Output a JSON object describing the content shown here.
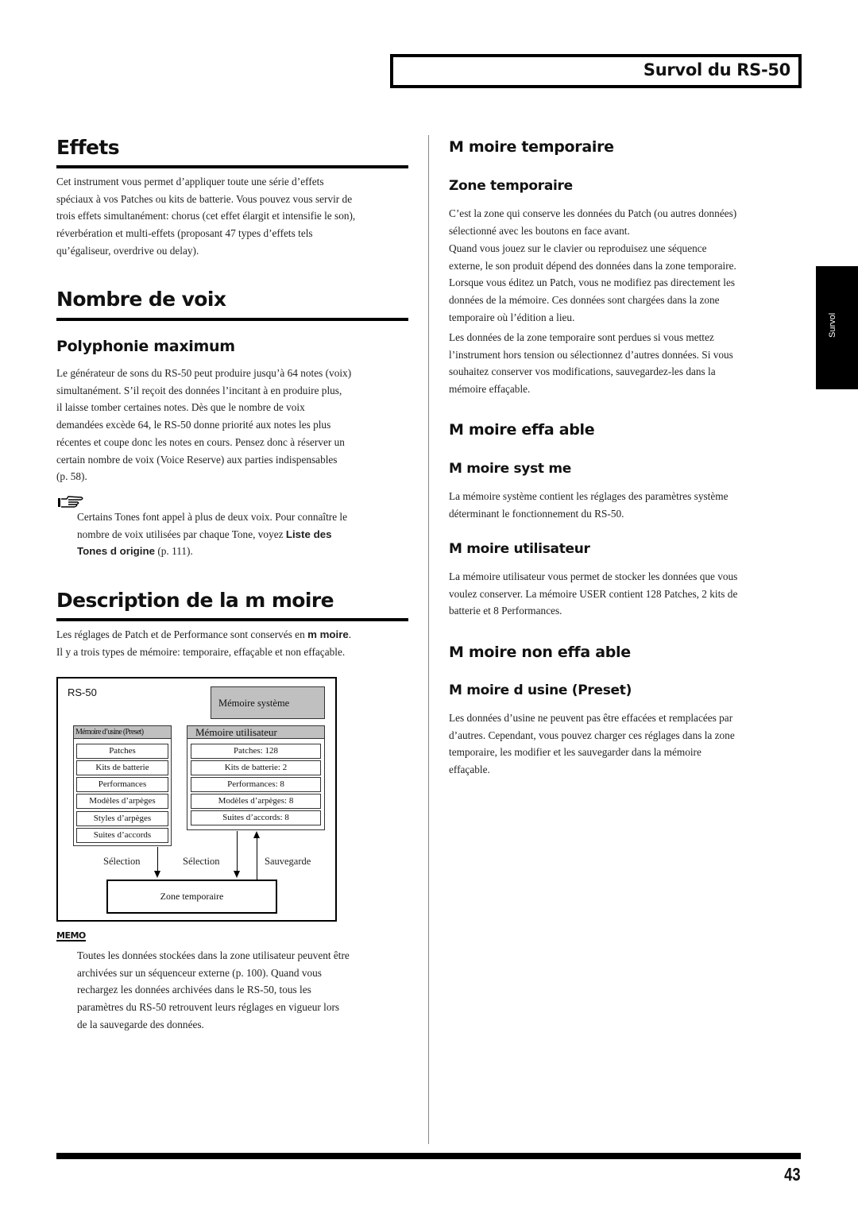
{
  "header": {
    "title": "Survol du RS-50"
  },
  "side_tab": {
    "label": "Survol"
  },
  "left": {
    "effets": {
      "heading": "Effets",
      "lines": [
        "Cet instrument vous permet d’appliquer toute une série d’effets",
        "spéciaux à vos Patches ou kits de batterie. Vous pouvez vous servir de",
        "trois effets simultanément: chorus (cet effet élargit et intensifie le son),",
        "réverbération et multi-effets (proposant 47 types d’effets tels",
        "qu’égaliseur, overdrive ou delay)."
      ]
    },
    "voix": {
      "heading": "Nombre de voix",
      "subheading": "Polyphonie maximum",
      "lines": [
        "Le générateur de sons du RS-50 peut produire jusqu’à 64 notes (voix)",
        "simultanément. S’il reçoit des données l’incitant à en produire plus,",
        "il laisse tomber certaines notes. Dès que le nombre de voix",
        "demandées excède 64, le RS-50 donne priorité aux notes les plus",
        "récentes et coupe donc les notes en cours. Pensez donc à réserver un",
        "certain nombre de voix (Voice Reserve) aux parties indispensables",
        "(p. 58)."
      ],
      "note": {
        "icon": "pointing-hand-icon",
        "line1": "Certains Tones font appel à plus de deux voix. Pour connaître le",
        "line2_text": "nombre de voix utilisées par chaque Tone, voyez ",
        "line2_bold": "Liste des",
        "line3_bold": "Tones d origine",
        "line3_text": " (p. 111)."
      }
    },
    "memoire": {
      "heading": "Description de la m  moire",
      "line1_text": "Les réglages de Patch et de Performance sont conservés en ",
      "line1_bold": "m  moire",
      "line1_end": ".",
      "line2": "Il y a trois types de mémoire: temporaire, effaçable et non effaçable."
    },
    "diagram": {
      "device": "RS-50",
      "system_memory": "Mémoire système",
      "preset": {
        "title": "Mémoire d’usine (Preset)",
        "items": [
          "Patches",
          "Kits de batterie",
          "Performances",
          "Modèles d’arpèges",
          "Styles d’arpèges",
          "Suites d’accords"
        ]
      },
      "user": {
        "title": "Mémoire utilisateur",
        "items": [
          "Patches: 128",
          "Kits de batterie: 2",
          "Performances: 8",
          "Modèles d’arpèges: 8",
          "Suites d’accords: 8"
        ]
      },
      "arrows": {
        "selection_preset": "Sélection",
        "selection_user": "Sélection",
        "save": "Sauvegarde"
      },
      "temp_zone": "Zone temporaire"
    },
    "memo": {
      "icon_label": "MEMO",
      "lines": [
        "Toutes les données stockées dans la zone utilisateur peuvent être",
        "archivées sur un séquenceur externe (p. 100). Quand vous",
        "rechargez les données archivées dans le RS-50, tous les",
        "paramètres du RS-50 retrouvent leurs réglages en vigueur lors",
        "de la sauvegarde des données."
      ]
    }
  },
  "right": {
    "temp": {
      "heading": "M  moire temporaire",
      "subheading": "Zone temporaire",
      "p1": [
        "C’est la zone qui conserve les données du Patch (ou autres données)",
        "sélectionné avec les boutons en face avant."
      ],
      "p2": [
        "Quand vous jouez sur le clavier ou reproduisez une séquence",
        "externe, le son produit dépend des données dans la zone temporaire.",
        "Lorsque vous éditez un Patch, vous ne modifiez pas directement les",
        "données de la mémoire. Ces données sont chargées dans la zone",
        "temporaire où l’édition a lieu."
      ],
      "p3": [
        "Les données de la zone temporaire sont perdues si vous mettez",
        "l’instrument hors tension ou sélectionnez d’autres données. Si vous",
        "souhaitez conserver vos modifications, sauvegardez-les dans la",
        "mémoire effaçable."
      ]
    },
    "effacable": {
      "heading": "M  moire effa  able",
      "system": {
        "subheading": "M  moire syst  me",
        "lines": [
          "La mémoire système contient les réglages des paramètres système",
          "déterminant le fonctionnement du RS-50."
        ]
      },
      "user": {
        "subheading": "M  moire utilisateur",
        "lines": [
          "La mémoire utilisateur vous permet de stocker les données que vous",
          "voulez conserver. La mémoire USER contient 128 Patches, 2 kits de",
          "batterie et 8 Performances."
        ]
      }
    },
    "non_effacable": {
      "heading": "M  moire non effa  able",
      "subheading": "M  moire d usine (Preset)",
      "lines": [
        "Les données d’usine ne peuvent pas être effacées et remplacées par",
        "d’autres. Cependant, vous pouvez charger ces réglages dans la zone",
        "temporaire, les modifier et les sauvegarder dans la mémoire",
        "effaçable."
      ]
    }
  },
  "footer": {
    "page_number": "43"
  }
}
